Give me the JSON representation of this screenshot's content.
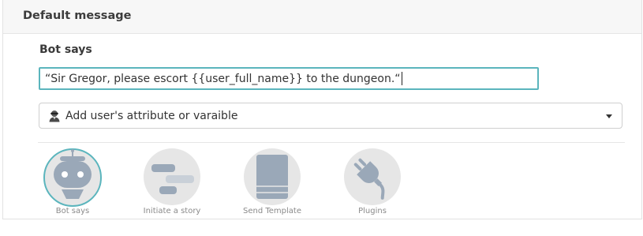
{
  "panel": {
    "title": "Default message"
  },
  "editor": {
    "section_title": "Bot says",
    "message_value": "“Sir Gregor, please escort {{user_full_name}} to the dungeon.“",
    "attribute_select": {
      "icon": "user-spy-icon",
      "selected_label": "Add user's attribute or varaible"
    }
  },
  "toolbar": {
    "items": [
      {
        "label": "Bot says",
        "icon": "robot-icon",
        "active": true
      },
      {
        "label": "Initiate a story",
        "icon": "gantt-bars-icon",
        "active": false
      },
      {
        "label": "Send Template",
        "icon": "template-card-icon",
        "active": false
      },
      {
        "label": "Plugins",
        "icon": "plug-icon",
        "active": false
      }
    ]
  },
  "colors": {
    "accent": "#5bb5bd",
    "icon_gray": "#9aa8b8",
    "circle_bg": "#e6e6e6"
  }
}
